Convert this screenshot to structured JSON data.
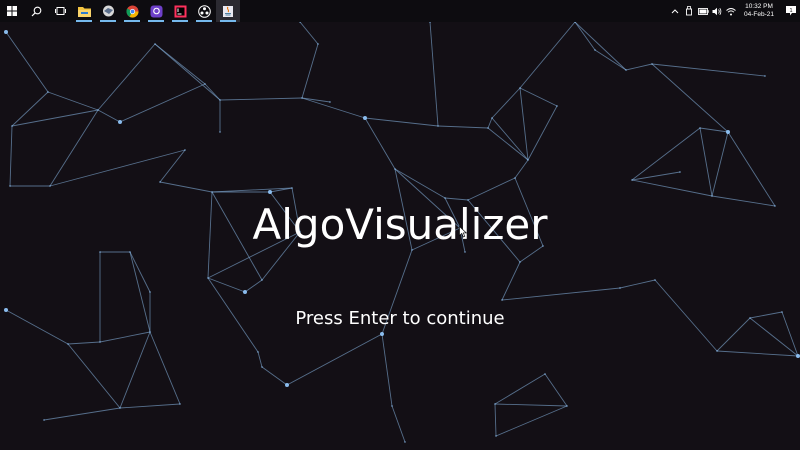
{
  "taskbar": {
    "items": [
      {
        "icon": "windows-start-icon"
      },
      {
        "icon": "search-icon"
      },
      {
        "icon": "task-view-icon"
      },
      {
        "icon": "file-explorer-icon"
      },
      {
        "icon": "app-icon"
      },
      {
        "icon": "chrome-icon"
      },
      {
        "icon": "github-icon"
      },
      {
        "icon": "intellij-icon"
      },
      {
        "icon": "obs-icon"
      },
      {
        "icon": "java-icon"
      }
    ],
    "tray": {
      "icons": [
        "chevron-up-icon",
        "usb-icon",
        "battery-icon",
        "volume-icon",
        "wifi-icon"
      ],
      "time": "10:32 PM",
      "date": "04-Feb-21",
      "notification_count": "1"
    }
  },
  "app": {
    "title": "AlgoVisualizer",
    "subtitle": "Press Enter to continue",
    "colors": {
      "background": "#130f15",
      "line": "#7fa9d4",
      "node": "#8fc3f5",
      "text": "#ffffff"
    }
  }
}
